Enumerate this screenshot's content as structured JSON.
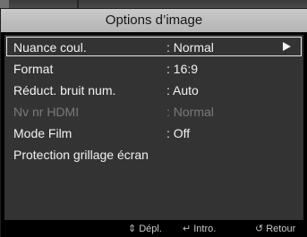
{
  "title": "Options d’image",
  "menu": [
    {
      "label": "Nuance coul.",
      "value": ": Normal",
      "selected": true,
      "enabled": true
    },
    {
      "label": "Format",
      "value": ": 16:9",
      "selected": false,
      "enabled": true
    },
    {
      "label": "Réduct. bruit num.",
      "value": ": Auto",
      "selected": false,
      "enabled": true
    },
    {
      "label": "Nv nr HDMI",
      "value": ": Normal",
      "selected": false,
      "enabled": false
    },
    {
      "label": "Mode Film",
      "value": ": Off",
      "selected": false,
      "enabled": true
    },
    {
      "label": "Protection grillage écran",
      "value": "",
      "selected": false,
      "enabled": true
    }
  ],
  "footer": {
    "move_icon": "up-down-arrows-icon",
    "move_label": "Dépl.",
    "enter_icon": "enter-key-icon",
    "enter_label": "Intro.",
    "return_icon": "return-arrow-icon",
    "return_label": "Retour"
  },
  "colors": {
    "title_bar": "#c0c0c0",
    "panel": "#333333",
    "disabled_text": "#7a7a7a"
  }
}
